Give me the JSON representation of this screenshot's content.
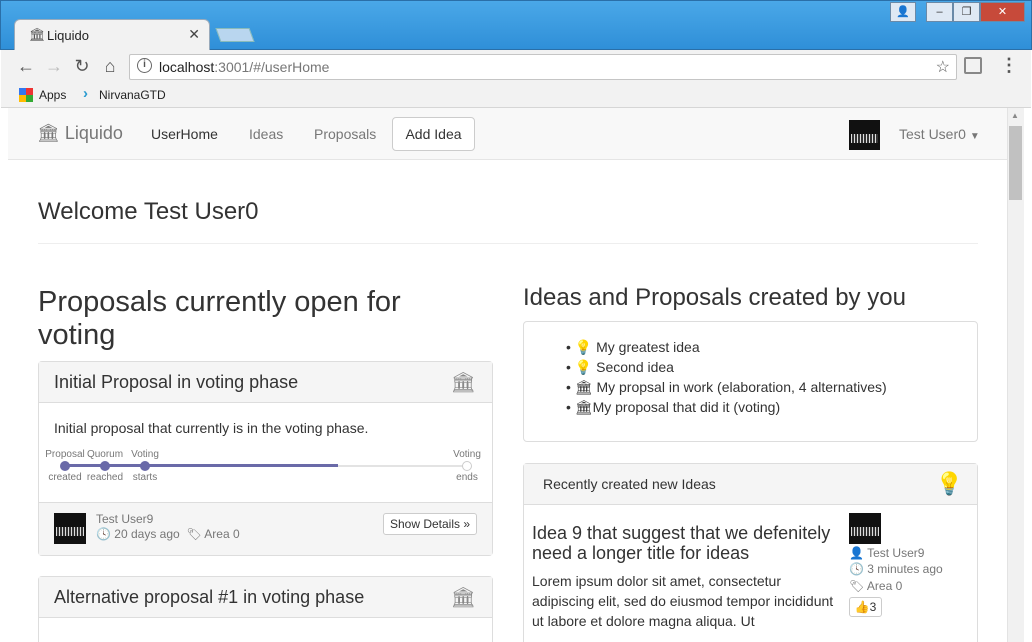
{
  "browser": {
    "tab_title": "Liquido",
    "url_host": "localhost",
    "url_rest": ":3001/#/userHome",
    "bookmarks": [
      "Apps",
      "NirvanaGTD"
    ],
    "window_buttons": [
      "‒",
      "❐",
      "✕"
    ]
  },
  "navbar": {
    "brand": "Liquido",
    "links": [
      "UserHome",
      "Ideas",
      "Proposals"
    ],
    "add_idea": "Add Idea",
    "user": "Test User0"
  },
  "welcome": "Welcome Test User0",
  "left": {
    "heading": "Proposals currently open for voting",
    "proposals": [
      {
        "title": "Initial Proposal in voting phase",
        "description": "Initial proposal that currently is in the voting phase.",
        "timeline": [
          {
            "top": "Proposal",
            "bottom": "created"
          },
          {
            "top": "Quorum",
            "bottom": "reached"
          },
          {
            "top": "Voting",
            "bottom": "starts"
          },
          {
            "top": "Voting",
            "bottom": "ends"
          }
        ],
        "progress": 0.68,
        "author": "Test User9",
        "age": "20 days ago",
        "area": "Area 0",
        "details_button": "Show Details »"
      },
      {
        "title": "Alternative proposal #1 in voting phase"
      }
    ]
  },
  "right": {
    "heading": "Ideas and Proposals created by you",
    "items": [
      {
        "icon": "lightbulb-icon",
        "text": "My greatest idea"
      },
      {
        "icon": "lightbulb-icon",
        "text": "Second idea"
      },
      {
        "icon": "bank-icon",
        "text": "My propsal in work (elaboration, 4 alternatives)"
      },
      {
        "icon": "bank-icon",
        "text": "My proposal that did it (voting)"
      }
    ],
    "recent": {
      "header": "Recently created new Ideas",
      "idea_title": "Idea 9 that suggest that we defenitely need a longer title for ideas",
      "idea_text": "Lorem ipsum dolor sit amet, consectetur adipiscing elit, sed do eiusmod tempor incididunt ut labore et dolore magna aliqua. Ut",
      "author": "Test User9",
      "age": "3 minutes ago",
      "area": "Area 0",
      "likes": "3"
    }
  },
  "colors": {
    "timeline": "#6a6aa8",
    "panel_border": "#dddddd"
  }
}
